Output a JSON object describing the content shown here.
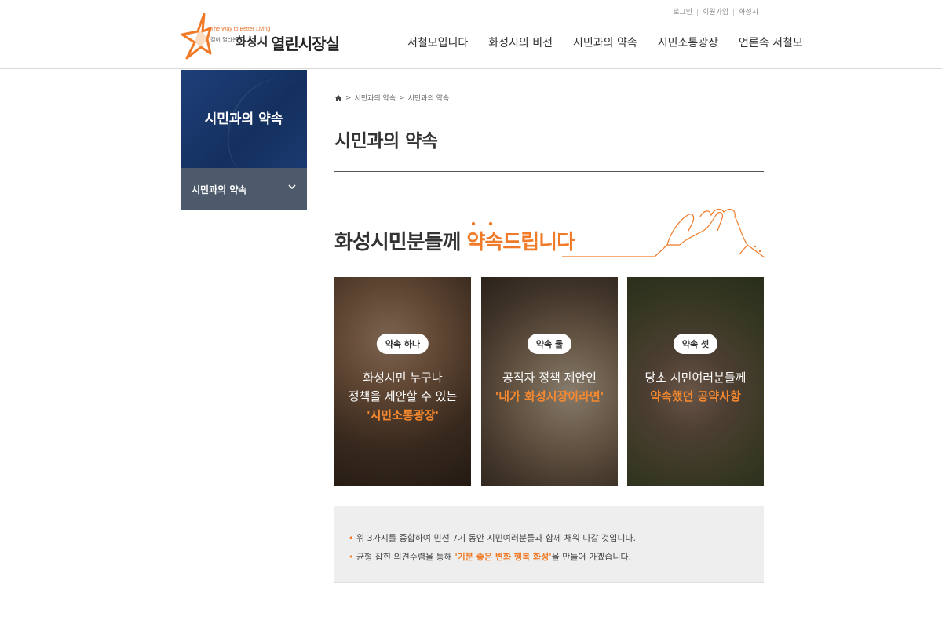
{
  "header": {
    "logo": {
      "tagline": "The Way to Better Living",
      "small_text": "길이 열리는",
      "city": "화성시",
      "office": "열린시장실"
    },
    "utility": [
      "로그인",
      "회원가입",
      "화성시"
    ],
    "nav": [
      "서철모입니다",
      "화성시의 비전",
      "시민과의 약속",
      "시민소통광장",
      "언론속 서철모"
    ]
  },
  "sidebar": {
    "title": "시민과의 약속",
    "menu_item": "시민과의 약속"
  },
  "breadcrumb": [
    "시민과의 약속",
    "시민과의 약속"
  ],
  "page_title": "시민과의 약속",
  "promise_heading": {
    "prefix": "화성시민분들께 ",
    "accent": "약속드립니다"
  },
  "cards": [
    {
      "badge": "약속 하나",
      "lines": [
        "화성시민 누구나",
        "정책을 제안할 수 있는"
      ],
      "highlight": "'시민소통광장'"
    },
    {
      "badge": "약속 둘",
      "lines": [
        "공직자 정책 제안인"
      ],
      "highlight": "'내가 화성시장이라면'"
    },
    {
      "badge": "약속 셋",
      "lines": [
        "당초 시민여러분들께"
      ],
      "highlight": "약속했던 공약사항"
    }
  ],
  "notice": {
    "line1": "위 3가지를 종합하여 민선 7기 동안 시민여러분들과 함께 채워 나갈 것입니다.",
    "line2_prefix": "균형 잡힌 의견수렴을 통해 ",
    "line2_highlight": "'기분 좋은 변화 행복 화성'",
    "line2_suffix": "을 만들어 가겠습니다."
  },
  "colors": {
    "accent": "#f07a27",
    "sidebar_blue": "#14305f",
    "sidebar_menu": "#4d5a6b"
  }
}
